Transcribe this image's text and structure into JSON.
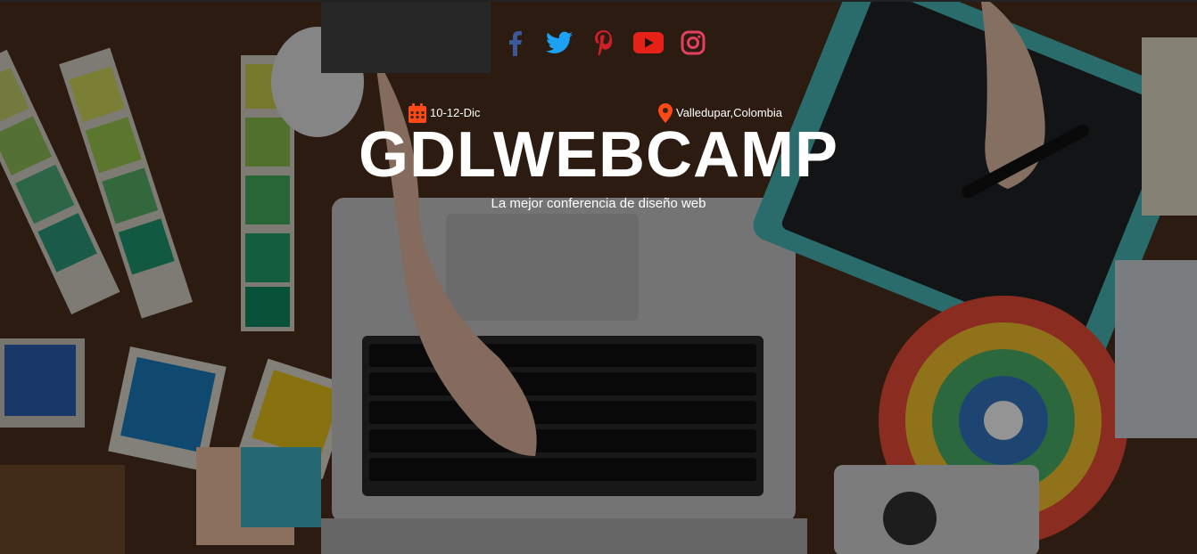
{
  "social": [
    {
      "name": "facebook-icon",
      "color": "#3b5998"
    },
    {
      "name": "twitter-icon",
      "color": "#1da1f2"
    },
    {
      "name": "pinterest-icon",
      "color": "#cb2027"
    },
    {
      "name": "youtube-icon",
      "color": "#e62117"
    },
    {
      "name": "instagram-icon",
      "color": "#e4405f"
    }
  ],
  "event": {
    "date": "10-12-Dic",
    "location": "Valledupar,Colombia",
    "accent_color": "#fe4918"
  },
  "hero": {
    "title": "GDLWEBCAMP",
    "tagline": "La mejor conferencia de diseño web"
  }
}
